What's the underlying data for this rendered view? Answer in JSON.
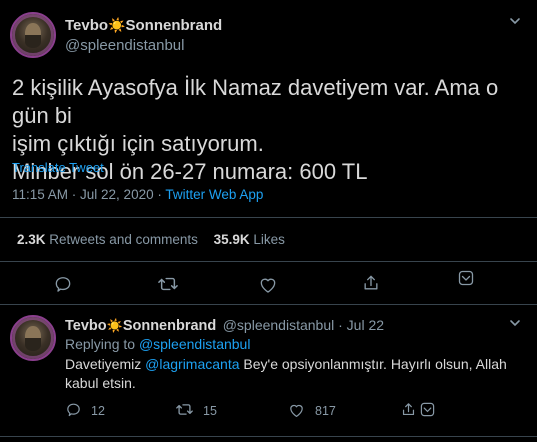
{
  "main": {
    "author_name_a": "Tevbo",
    "author_sun": "☀️",
    "author_name_b": "Sonnenbrand",
    "handle": "@spleendistanbul",
    "text_line1": "2 kişilik Ayasofya İlk Namaz davetiyem var. Ama o gün bi",
    "text_line2": "işim çıktığı için satıyorum.",
    "text_line3": "Minber sol ön 26-27 numara: 600 TL",
    "translate": "Translate Tweet",
    "time": "11:15 AM · Jul 22, 2020 · ",
    "source": "Twitter Web App",
    "retweets_count": "2.3K",
    "retweets_label": " Retweets and comments",
    "likes_count": "35.9K",
    "likes_label": " Likes"
  },
  "reply": {
    "author_name_a": "Tevbo",
    "author_sun": "☀️",
    "author_name_b": "Sonnenbrand",
    "handle_date": "@spleendistanbul · Jul 22",
    "replying_prefix": "Replying to ",
    "replying_to": "@spleendistanbul",
    "text_a": "Davetiyemiz ",
    "text_mention": "@lagrimacanta",
    "text_b": " Bey'e opsiyonlanmıştır. Hayırlı olsun, Allah",
    "text_line2": "kabul etsin.",
    "reply_count": "12",
    "retweet_count": "15",
    "like_count": "817"
  },
  "colors": {
    "background": "#000000",
    "text": "#d9d9d9",
    "secondary": "#8899a6",
    "accent": "#1da1f2",
    "divider": "#38444d"
  },
  "icons": {
    "reply": "reply-icon",
    "retweet": "retweet-icon",
    "like": "heart-icon",
    "share": "share-icon",
    "tip": "tip-icon",
    "menu": "chevron-down-icon"
  }
}
